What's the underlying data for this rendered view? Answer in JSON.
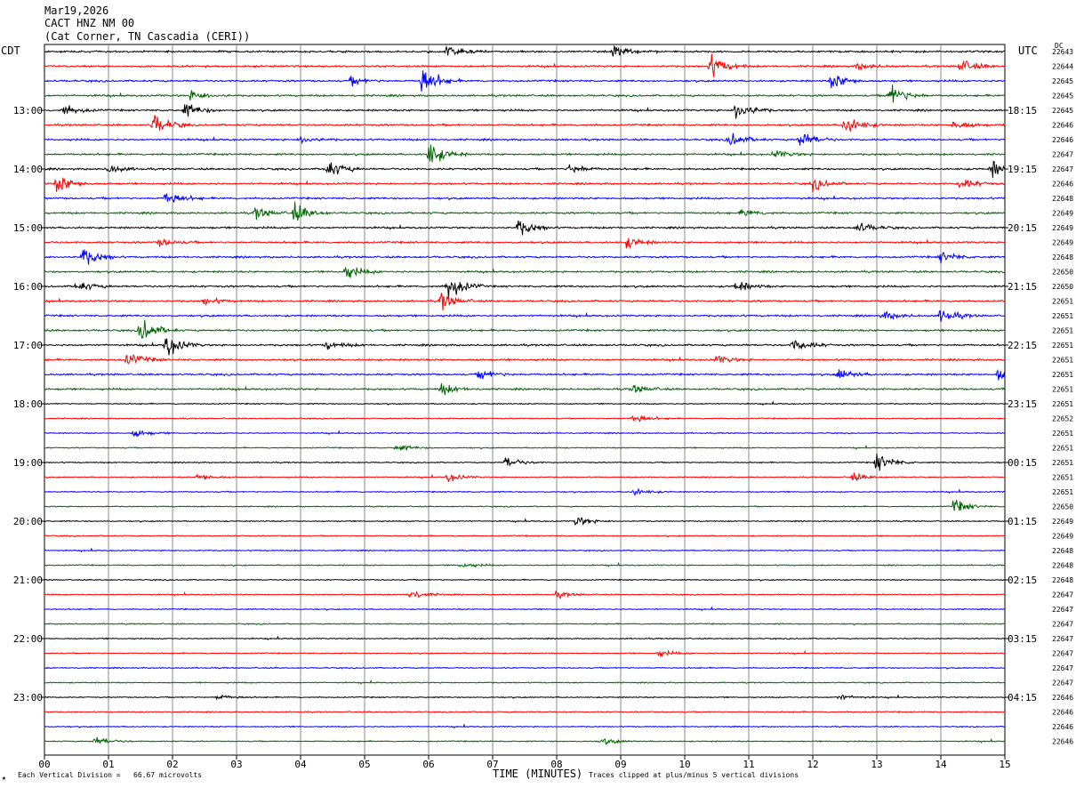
{
  "header": {
    "date": "Mar19,2026",
    "station": "CACT HNZ NM 00",
    "location": "(Cat Corner, TN Cascadia (CERI))"
  },
  "labels": {
    "left_zone": "CDT",
    "right_zone": "UTC",
    "dc_label": "DC",
    "x_title": "TIME (MINUTES)",
    "vertical_division": "Each Vertical Division =   66.67 microvolts",
    "clip_note": "Traces clipped at plus/minus 5 vertical divisions",
    "corner_mark": "★"
  },
  "chart_data": {
    "type": "line",
    "subtype": "helicorder",
    "x_ticks": [
      "00",
      "01",
      "02",
      "03",
      "04",
      "05",
      "06",
      "07",
      "08",
      "09",
      "10",
      "11",
      "12",
      "13",
      "14",
      "15"
    ],
    "xlim": [
      0,
      15
    ],
    "trace_colors": [
      "#000000",
      "#ff0000",
      "#0000ff",
      "#006400"
    ],
    "left_hour_labels": [
      "13:00",
      "14:00",
      "15:00",
      "16:00",
      "17:00",
      "18:00",
      "19:00",
      "20:00",
      "21:00",
      "22:00",
      "23:00"
    ],
    "right_hour_labels": [
      "18:15",
      "19:15",
      "20:15",
      "21:15",
      "22:15",
      "23:15",
      "00:15",
      "01:15",
      "02:15",
      "03:15",
      "04:15"
    ],
    "first_labeled_row": 4,
    "dc_offsets": [
      "22643",
      "22644",
      "22645",
      "22645",
      "22645",
      "22646",
      "22646",
      "22647",
      "22647",
      "22646",
      "22648",
      "22649",
      "22649",
      "22649",
      "22648",
      "22650",
      "22650",
      "22651",
      "22651",
      "22651",
      "22651",
      "22651",
      "22651",
      "22651",
      "22651",
      "22652",
      "22651",
      "22651",
      "22651",
      "22651",
      "22651",
      "22650",
      "22649",
      "22649",
      "22648",
      "22648",
      "22648",
      "22647",
      "22647",
      "22647",
      "22647",
      "22647",
      "22647",
      "22647",
      "22646",
      "22646",
      "22646",
      "22646"
    ],
    "events": [
      {
        "row": 0,
        "minute": 6.3,
        "amp": 2.5
      },
      {
        "row": 0,
        "minute": 8.9,
        "amp": 2.0
      },
      {
        "row": 1,
        "minute": 10.4,
        "amp": 4.0
      },
      {
        "row": 1,
        "minute": 14.3,
        "amp": 2.5
      },
      {
        "row": 1,
        "minute": 12.7,
        "amp": 1.2
      },
      {
        "row": 2,
        "minute": 5.9,
        "amp": 5.0
      },
      {
        "row": 2,
        "minute": 12.3,
        "amp": 3.0
      },
      {
        "row": 2,
        "minute": 4.8,
        "amp": 1.5
      },
      {
        "row": 3,
        "minute": 13.2,
        "amp": 4.5
      },
      {
        "row": 3,
        "minute": 2.3,
        "amp": 2.0
      },
      {
        "row": 4,
        "minute": 10.8,
        "amp": 4.0
      },
      {
        "row": 4,
        "minute": 2.2,
        "amp": 2.5
      },
      {
        "row": 4,
        "minute": 0.3,
        "amp": 2.0
      },
      {
        "row": 5,
        "minute": 1.7,
        "amp": 4.0
      },
      {
        "row": 5,
        "minute": 12.5,
        "amp": 3.5
      },
      {
        "row": 5,
        "minute": 14.2,
        "amp": 2.0
      },
      {
        "row": 6,
        "minute": 11.8,
        "amp": 3.0
      },
      {
        "row": 6,
        "minute": 10.7,
        "amp": 2.5
      },
      {
        "row": 6,
        "minute": 4.0,
        "amp": 1.5
      },
      {
        "row": 7,
        "minute": 6.0,
        "amp": 4.5
      },
      {
        "row": 7,
        "minute": 11.4,
        "amp": 1.5
      },
      {
        "row": 8,
        "minute": 4.4,
        "amp": 3.5
      },
      {
        "row": 8,
        "minute": 14.8,
        "amp": 3.0
      },
      {
        "row": 8,
        "minute": 8.2,
        "amp": 2.0
      },
      {
        "row": 8,
        "minute": 1.0,
        "amp": 1.5
      },
      {
        "row": 9,
        "minute": 0.2,
        "amp": 3.5
      },
      {
        "row": 9,
        "minute": 12.0,
        "amp": 2.0
      },
      {
        "row": 9,
        "minute": 14.3,
        "amp": 2.0
      },
      {
        "row": 10,
        "minute": 1.9,
        "amp": 2.5
      },
      {
        "row": 11,
        "minute": 3.9,
        "amp": 3.5
      },
      {
        "row": 11,
        "minute": 3.3,
        "amp": 2.0
      },
      {
        "row": 11,
        "minute": 10.9,
        "amp": 1.5
      },
      {
        "row": 12,
        "minute": 7.4,
        "amp": 3.0
      },
      {
        "row": 12,
        "minute": 12.7,
        "amp": 2.0
      },
      {
        "row": 13,
        "minute": 9.1,
        "amp": 2.0
      },
      {
        "row": 13,
        "minute": 1.8,
        "amp": 1.5
      },
      {
        "row": 14,
        "minute": 0.6,
        "amp": 3.5
      },
      {
        "row": 14,
        "minute": 14.0,
        "amp": 2.0
      },
      {
        "row": 15,
        "minute": 4.7,
        "amp": 2.5
      },
      {
        "row": 16,
        "minute": 6.3,
        "amp": 5.0
      },
      {
        "row": 16,
        "minute": 0.5,
        "amp": 2.0
      },
      {
        "row": 16,
        "minute": 10.8,
        "amp": 2.0
      },
      {
        "row": 17,
        "minute": 6.2,
        "amp": 3.0
      },
      {
        "row": 17,
        "minute": 2.5,
        "amp": 1.2
      },
      {
        "row": 18,
        "minute": 14.0,
        "amp": 2.5
      },
      {
        "row": 18,
        "minute": 13.1,
        "amp": 1.5
      },
      {
        "row": 19,
        "minute": 1.5,
        "amp": 4.5
      },
      {
        "row": 20,
        "minute": 1.9,
        "amp": 4.0
      },
      {
        "row": 20,
        "minute": 11.7,
        "amp": 2.5
      },
      {
        "row": 20,
        "minute": 4.4,
        "amp": 1.5
      },
      {
        "row": 21,
        "minute": 1.3,
        "amp": 2.5
      },
      {
        "row": 21,
        "minute": 10.5,
        "amp": 1.5
      },
      {
        "row": 22,
        "minute": 6.8,
        "amp": 2.0
      },
      {
        "row": 22,
        "minute": 12.4,
        "amp": 2.0
      },
      {
        "row": 22,
        "minute": 14.9,
        "amp": 2.5
      },
      {
        "row": 23,
        "minute": 6.2,
        "amp": 2.0
      },
      {
        "row": 23,
        "minute": 9.2,
        "amp": 1.5
      },
      {
        "row": 25,
        "minute": 9.2,
        "amp": 1.5
      },
      {
        "row": 26,
        "minute": 1.4,
        "amp": 1.5
      },
      {
        "row": 27,
        "minute": 5.5,
        "amp": 1.2
      },
      {
        "row": 28,
        "minute": 13.0,
        "amp": 3.5
      },
      {
        "row": 28,
        "minute": 7.2,
        "amp": 2.0
      },
      {
        "row": 29,
        "minute": 12.6,
        "amp": 1.5
      },
      {
        "row": 29,
        "minute": 2.4,
        "amp": 1.5
      },
      {
        "row": 29,
        "minute": 6.3,
        "amp": 1.5
      },
      {
        "row": 30,
        "minute": 9.2,
        "amp": 1.2
      },
      {
        "row": 31,
        "minute": 14.2,
        "amp": 2.5
      },
      {
        "row": 32,
        "minute": 8.3,
        "amp": 1.8
      },
      {
        "row": 35,
        "minute": 6.5,
        "amp": 1.0
      },
      {
        "row": 37,
        "minute": 5.7,
        "amp": 1.8
      },
      {
        "row": 37,
        "minute": 8.0,
        "amp": 1.0
      },
      {
        "row": 41,
        "minute": 9.6,
        "amp": 1.0
      },
      {
        "row": 44,
        "minute": 2.7,
        "amp": 1.0
      },
      {
        "row": 44,
        "minute": 12.4,
        "amp": 1.0
      },
      {
        "row": 47,
        "minute": 0.8,
        "amp": 1.5
      },
      {
        "row": 47,
        "minute": 8.7,
        "amp": 1.2
      }
    ]
  }
}
